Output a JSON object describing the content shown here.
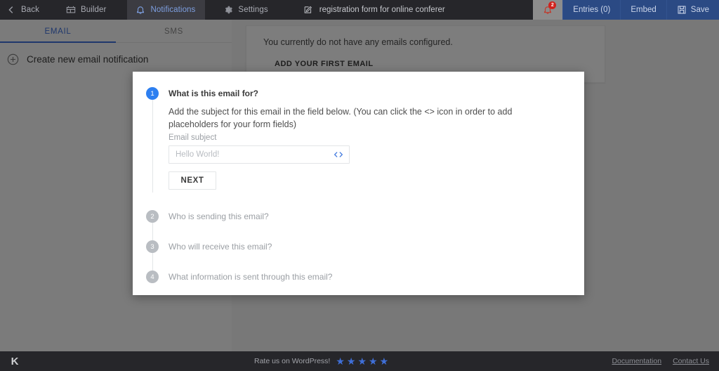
{
  "topbar": {
    "back_label": "Back",
    "builder_label": "Builder",
    "notifications_label": "Notifications",
    "settings_label": "Settings",
    "form_name": "registration form for online conferer",
    "notification_badge": "2",
    "entries_label": "Entries (0)",
    "embed_label": "Embed",
    "save_label": "Save",
    "accent_color": "#2b4a84",
    "active_tab_color": "#7d9fe0",
    "badge_color": "#d0211c"
  },
  "left_panel": {
    "tabs": [
      {
        "label": "EMAIL",
        "active": true
      },
      {
        "label": "SMS",
        "active": false
      }
    ],
    "create_label": "Create new email notification",
    "active_color": "#3f6fd8"
  },
  "main": {
    "empty_message": "You currently do not have any emails configured.",
    "add_first_label": "ADD YOUR FIRST EMAIL"
  },
  "modal": {
    "steps": [
      {
        "number": "1",
        "title": "What is this email for?",
        "active": true,
        "description": "Add the subject for this email in the field below. (You can click the <> icon in order to add placeholders for your form fields)",
        "field_label": "Email subject",
        "field_value": "",
        "field_placeholder": "Hello World!",
        "code_icon": "code-brackets-icon",
        "next_label": "NEXT"
      },
      {
        "number": "2",
        "title": "Who is sending this email?",
        "active": false
      },
      {
        "number": "3",
        "title": "Who will receive this email?",
        "active": false
      },
      {
        "number": "4",
        "title": "What information is sent through this email?",
        "active": false
      }
    ],
    "active_bullet_color": "#2d7ff0",
    "inactive_bullet_color": "#b9bdc2"
  },
  "bottombar": {
    "logo": "K",
    "rate_label": "Rate us on WordPress!",
    "star_count": 5,
    "star_color": "#3f6fd8",
    "documentation_label": "Documentation",
    "contact_label": "Contact Us"
  }
}
